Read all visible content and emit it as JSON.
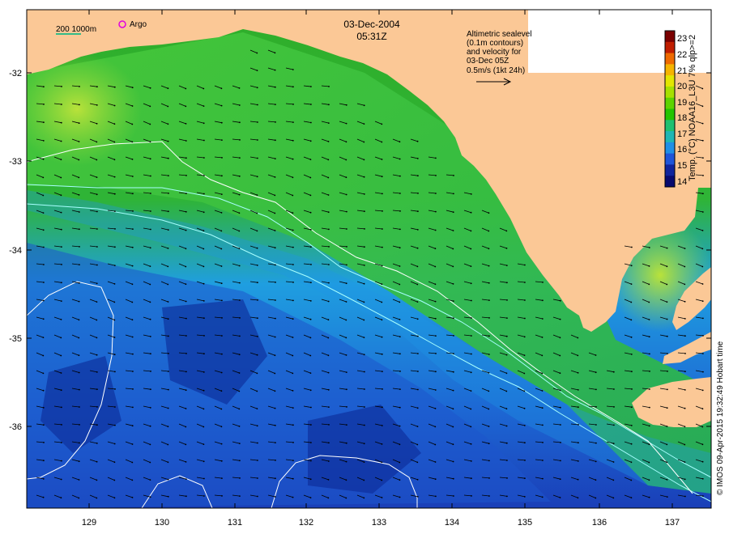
{
  "title": {
    "date": "03-Dec-2004",
    "time": "05:31Z"
  },
  "scale_bar": {
    "label": "200  1000m"
  },
  "argo": {
    "label": "Argo"
  },
  "altimetry_note": {
    "lines": [
      "Altimetric sealevel",
      "(0.1m contours)",
      "and velocity for",
      "03-Dec 05Z",
      "0.5m/s (1kt 24h)"
    ]
  },
  "colorbar": {
    "label": "Temp. (°C) NOAA16_L3U 7% qlp>=2",
    "ticks": [
      "23",
      "22",
      "21",
      "20",
      "19",
      "18",
      "17",
      "16",
      "15",
      "14"
    ],
    "colors": [
      "#7a0000",
      "#c01e00",
      "#ee6a00",
      "#f5b400",
      "#e2e600",
      "#a6e000",
      "#5ed300",
      "#24c400",
      "#1fc070",
      "#1fb6b4",
      "#1f8fe6",
      "#1f55d9",
      "#10249c",
      "#080a6e"
    ]
  },
  "axes": {
    "x_ticks": [
      "129",
      "130",
      "131",
      "132",
      "133",
      "134",
      "135",
      "136",
      "137"
    ],
    "y_ticks": [
      "-32",
      "-33",
      "-34",
      "-35",
      "-36"
    ]
  },
  "credit": "© IMOS 09-Apr-2015 19:32:49 Hobart time",
  "colors": {
    "land": "#fbc896",
    "sst_cool": "#1f74d4",
    "sst_mid": "#3fc030",
    "sst_warm": "#aee030",
    "contour": "#ffffff",
    "isobath": "#a8ffff",
    "argo_marker": "#e000e0",
    "scale_line": "#33bb88"
  }
}
